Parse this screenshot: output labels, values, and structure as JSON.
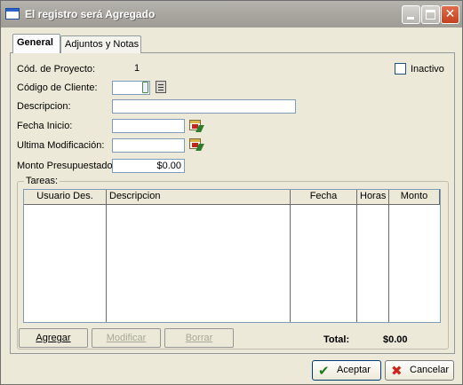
{
  "window": {
    "title": "El registro será Agregado",
    "minimize_icon": "minimize-icon",
    "maximize_icon": "maximize-icon",
    "close_icon": "close-icon"
  },
  "tabs": [
    {
      "label": "General",
      "active": true
    },
    {
      "label": "Adjuntos y Notas",
      "active": false
    }
  ],
  "form": {
    "project_code_label": "Cód. de Proyecto:",
    "project_code_value": "1",
    "inactive_label": "Inactivo",
    "inactive_checked": false,
    "client_code_label": "Código de Cliente:",
    "client_code_value": "",
    "description_label": "Descripcion:",
    "description_value": "",
    "start_date_label": "Fecha Inicio:",
    "start_date_value": "",
    "last_modified_label": "Ultima Modificación:",
    "last_modified_value": "",
    "budget_label": "Monto Presupuestado:",
    "budget_value": "$0.00"
  },
  "tasks": {
    "group_title": "Tareas:",
    "columns": [
      "Usuario Des.",
      "Descripcion",
      "Fecha",
      "Horas",
      "Monto"
    ],
    "rows": [],
    "add_label": "Agregar",
    "modify_label": "Modificar",
    "delete_label": "Borrar",
    "total_label": "Total:",
    "total_value": "$0.00"
  },
  "footer": {
    "accept_label": "Aceptar",
    "cancel_label": "Cancelar"
  },
  "colors": {
    "accept_icon": "#1a7f1a",
    "cancel_icon": "#d0221a"
  }
}
